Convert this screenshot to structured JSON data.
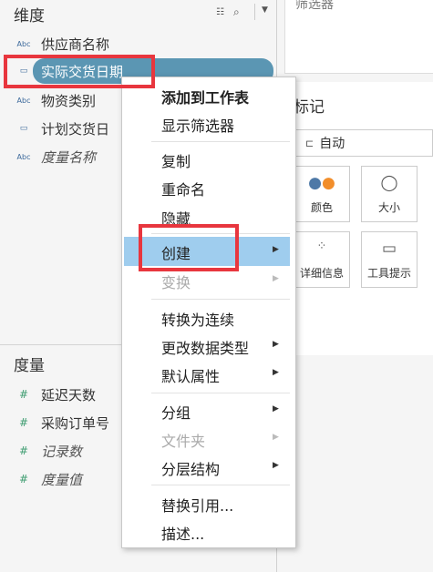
{
  "data_pane": {
    "dimensions_title": "维度",
    "dimensions": [
      {
        "name": "供应商名称",
        "type": "Abc",
        "italic": false
      },
      {
        "name": "实际交货日期",
        "type": "date",
        "italic": false,
        "selected": true
      },
      {
        "name": "物资类别",
        "type": "Abc",
        "italic": false
      },
      {
        "name": "计划交货日",
        "type": "date",
        "italic": false
      },
      {
        "name": "度量名称",
        "type": "Abc",
        "italic": true
      }
    ],
    "measures_title": "度量",
    "measures": [
      {
        "name": "延迟天数",
        "type": "#",
        "italic": false
      },
      {
        "name": "采购订单号",
        "type": "#",
        "italic": false
      },
      {
        "name": "记录数",
        "type": "#",
        "italic": true
      },
      {
        "name": "度量值",
        "type": "#",
        "italic": true
      }
    ]
  },
  "right_pane": {
    "top_text": "筛选器",
    "marks_title": "标记",
    "marks_type": "自动",
    "mark_buttons": [
      {
        "label": "颜色",
        "icon": "color-icon"
      },
      {
        "label": "大小",
        "icon": "size-icon"
      },
      {
        "label": "详细信息",
        "icon": "detail-icon"
      },
      {
        "label": "工具提示",
        "icon": "tooltip-icon"
      }
    ]
  },
  "context_menu": {
    "items": [
      {
        "label": "添加到工作表",
        "bold": true
      },
      {
        "label": "显示筛选器"
      },
      {
        "label": "复制"
      },
      {
        "label": "重命名"
      },
      {
        "label": "隐藏"
      },
      {
        "label": "创建",
        "submenu": true,
        "highlighted": true
      },
      {
        "label": "变换",
        "submenu": true,
        "disabled": true
      },
      {
        "label": "转换为连续"
      },
      {
        "label": "更改数据类型",
        "submenu": true
      },
      {
        "label": "默认属性",
        "submenu": true
      },
      {
        "label": "分组",
        "submenu": true
      },
      {
        "label": "文件夹",
        "submenu": true,
        "disabled": true
      },
      {
        "label": "分层结构",
        "submenu": true
      },
      {
        "label": "替换引用..."
      },
      {
        "label": "描述..."
      }
    ]
  },
  "colors": {
    "selected_pill": "#5b96b3",
    "menu_highlight": "#9fcdee",
    "annotation_box": "#e8363e"
  }
}
